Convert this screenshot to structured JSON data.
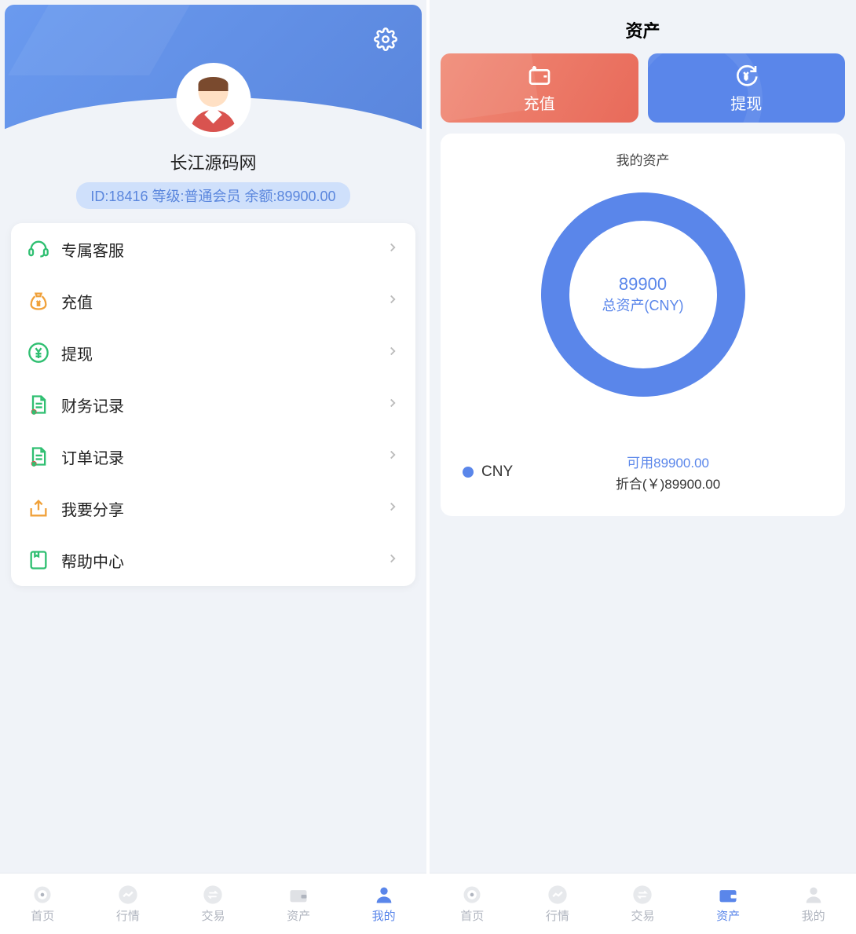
{
  "left": {
    "username": "长江源码网",
    "user_badge": "ID:18416  等级:普通会员  余额:89900.00",
    "menu": [
      {
        "label": "专属客服",
        "icon": "headset",
        "color": "#2fbf71"
      },
      {
        "label": "充值",
        "icon": "moneybag",
        "color": "#f0a13a"
      },
      {
        "label": "提现",
        "icon": "yen-circle",
        "color": "#2fbf71"
      },
      {
        "label": "财务记录",
        "icon": "doc-finance",
        "color": "#2fbf71"
      },
      {
        "label": "订单记录",
        "icon": "doc-order",
        "color": "#2fbf71"
      },
      {
        "label": "我要分享",
        "icon": "share",
        "color": "#f0a13a"
      },
      {
        "label": "帮助中心",
        "icon": "book",
        "color": "#2fbf71"
      }
    ],
    "nav": {
      "items": [
        "首页",
        "行情",
        "交易",
        "资产",
        "我的"
      ],
      "active_index": 4
    }
  },
  "right": {
    "header": "资产",
    "recharge_label": "充值",
    "withdraw_label": "提现",
    "assets_title": "我的资产",
    "donut_value": "89900",
    "donut_label": "总资产(CNY)",
    "legend_name": "CNY",
    "legend_avail": "可用89900.00",
    "legend_equiv": "折合(￥)89900.00",
    "nav": {
      "items": [
        "首页",
        "行情",
        "交易",
        "资产",
        "我的"
      ],
      "active_index": 3
    }
  },
  "chart_data": {
    "type": "pie",
    "title": "我的资产",
    "categories": [
      "CNY"
    ],
    "values": [
      89900
    ],
    "series": [
      {
        "name": "CNY",
        "values": [
          89900
        ]
      }
    ],
    "total_label": "总资产(CNY)",
    "total_value": 89900
  }
}
